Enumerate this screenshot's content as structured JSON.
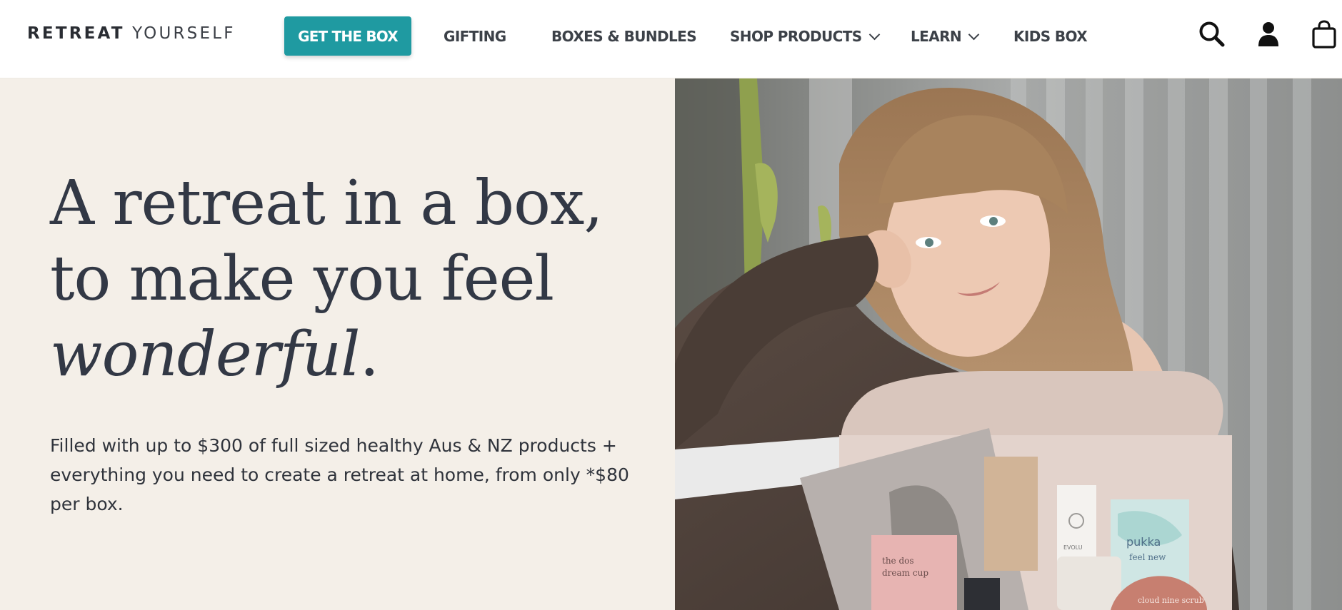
{
  "header": {
    "logo": {
      "primary": "RETREAT",
      "secondary": "YOURSELF"
    },
    "cta": {
      "label": "GET THE BOX",
      "color": "#1f9aa1"
    },
    "nav": [
      {
        "label": "GIFTING",
        "has_dropdown": false
      },
      {
        "label": "BOXES & BUNDLES",
        "has_dropdown": false
      },
      {
        "label": "SHOP PRODUCTS",
        "has_dropdown": true,
        "icon": "chevron-down-icon"
      },
      {
        "label": "LEARN",
        "has_dropdown": true,
        "icon": "chevron-down-icon"
      },
      {
        "label": "KIDS BOX",
        "has_dropdown": false
      }
    ],
    "icons": [
      "search-icon",
      "account-icon",
      "cart-icon"
    ]
  },
  "hero": {
    "heading": {
      "line1": "A retreat in a box,",
      "line2": "to make you feel",
      "line3_italic": "wonderful",
      "line3_suffix": "."
    },
    "subheading": "Filled with up to $300 of full sized healthy Aus & NZ products + everything you need to create a retreat at home, from only *$80 per box.",
    "background_color": "#f4efe8",
    "image": {
      "product_labels": [
        "pukka",
        "feel new",
        "the dos",
        "dream cup",
        "cloud nine scrub",
        "EVOLU"
      ]
    }
  }
}
